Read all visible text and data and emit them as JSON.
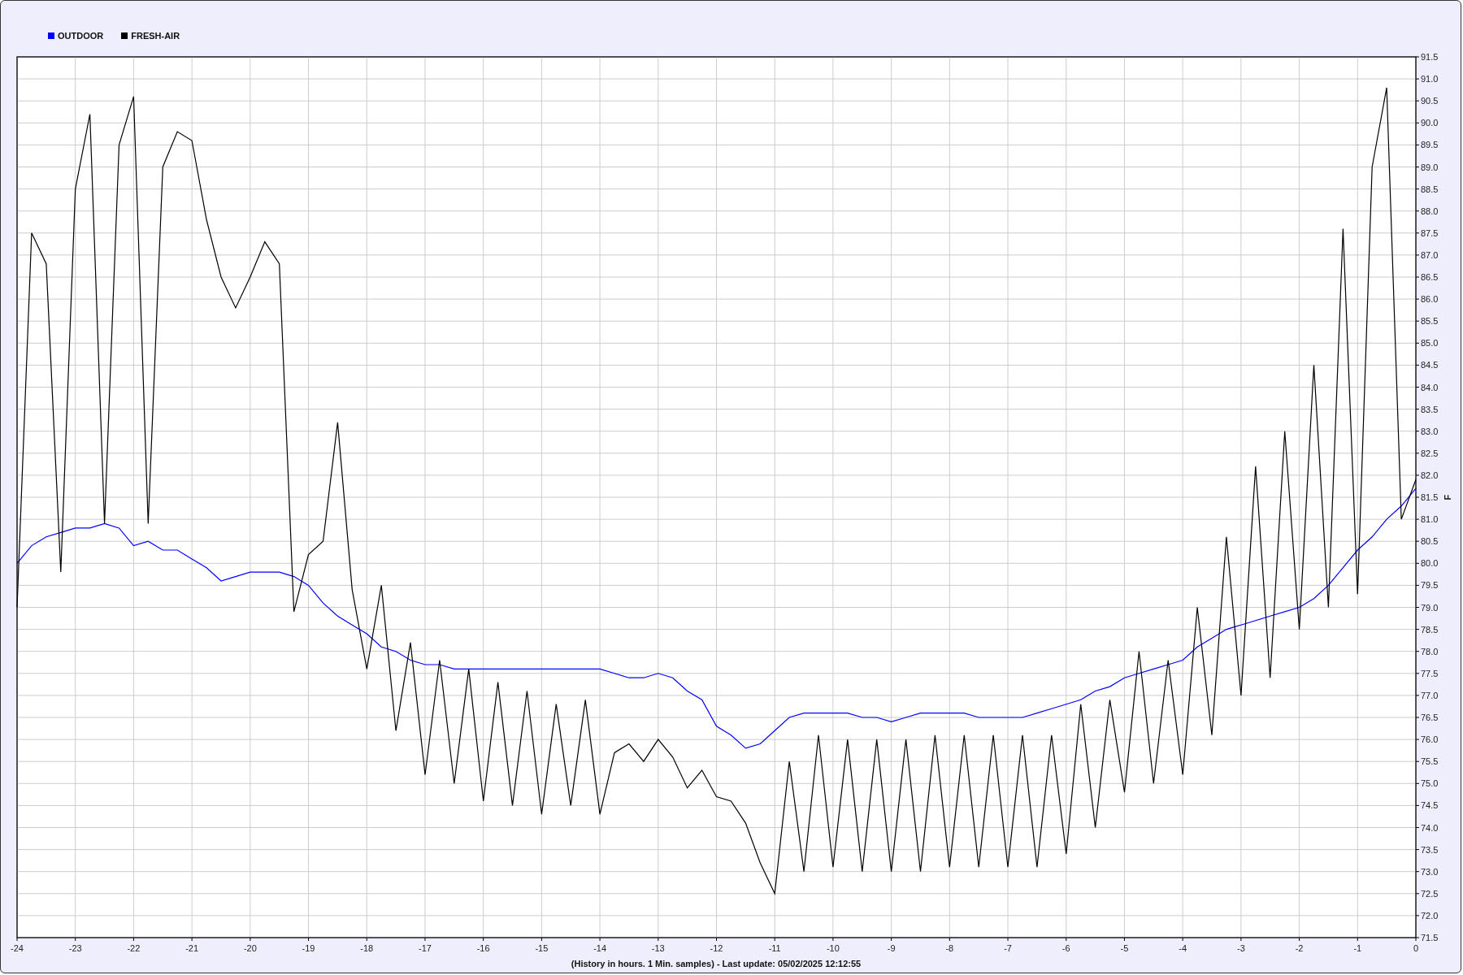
{
  "chart_data": {
    "type": "line",
    "grid": true,
    "xlabel": "(History in hours. 1 Min. samples) - Last update: 05/02/2025 12:12:55",
    "ylabel": "F",
    "x": [
      -24,
      -23.75,
      -23.5,
      -23.25,
      -23,
      -22.75,
      -22.5,
      -22.25,
      -22,
      -21.75,
      -21.5,
      -21.25,
      -21,
      -20.75,
      -20.5,
      -20.25,
      -20,
      -19.75,
      -19.5,
      -19.25,
      -19,
      -18.75,
      -18.5,
      -18.25,
      -18,
      -17.75,
      -17.5,
      -17.25,
      -17,
      -16.75,
      -16.5,
      -16.25,
      -16,
      -15.75,
      -15.5,
      -15.25,
      -15,
      -14.75,
      -14.5,
      -14.25,
      -14,
      -13.75,
      -13.5,
      -13.25,
      -13,
      -12.75,
      -12.5,
      -12.25,
      -12,
      -11.75,
      -11.5,
      -11.25,
      -11,
      -10.75,
      -10.5,
      -10.25,
      -10,
      -9.75,
      -9.5,
      -9.25,
      -9,
      -8.75,
      -8.5,
      -8.25,
      -8,
      -7.75,
      -7.5,
      -7.25,
      -7,
      -6.75,
      -6.5,
      -6.25,
      -6,
      -5.75,
      -5.5,
      -5.25,
      -5,
      -4.75,
      -4.5,
      -4.25,
      -4,
      -3.75,
      -3.5,
      -3.25,
      -3,
      -2.75,
      -2.5,
      -2.25,
      -2,
      -1.75,
      -1.5,
      -1.25,
      -1,
      -0.75,
      -0.5,
      -0.25,
      0
    ],
    "series": [
      {
        "name": "OUTDOOR",
        "color": "#0000ff",
        "values": [
          80.0,
          80.4,
          80.6,
          80.7,
          80.8,
          80.8,
          80.9,
          80.8,
          80.4,
          80.5,
          80.3,
          80.3,
          80.1,
          79.9,
          79.6,
          79.7,
          79.8,
          79.8,
          79.8,
          79.7,
          79.5,
          79.1,
          78.8,
          78.6,
          78.4,
          78.1,
          78.0,
          77.8,
          77.7,
          77.7,
          77.6,
          77.6,
          77.6,
          77.6,
          77.6,
          77.6,
          77.6,
          77.6,
          77.6,
          77.6,
          77.6,
          77.5,
          77.4,
          77.4,
          77.5,
          77.4,
          77.1,
          76.9,
          76.3,
          76.1,
          75.8,
          75.9,
          76.2,
          76.5,
          76.6,
          76.6,
          76.6,
          76.6,
          76.5,
          76.5,
          76.4,
          76.5,
          76.6,
          76.6,
          76.6,
          76.6,
          76.5,
          76.5,
          76.5,
          76.5,
          76.6,
          76.7,
          76.8,
          76.9,
          77.1,
          77.2,
          77.4,
          77.5,
          77.6,
          77.7,
          77.8,
          78.1,
          78.3,
          78.5,
          78.6,
          78.7,
          78.8,
          78.9,
          79.0,
          79.2,
          79.5,
          79.9,
          80.3,
          80.6,
          81.0,
          81.3,
          81.7
        ]
      },
      {
        "name": "FRESH-AIR",
        "color": "#000000",
        "values": [
          79.0,
          87.5,
          86.8,
          79.8,
          88.5,
          90.2,
          80.9,
          89.5,
          90.6,
          80.9,
          89.0,
          89.8,
          89.6,
          87.8,
          86.5,
          85.8,
          86.5,
          87.3,
          86.8,
          78.9,
          80.2,
          80.5,
          83.2,
          79.4,
          77.6,
          79.5,
          76.2,
          78.2,
          75.2,
          77.8,
          75.0,
          77.6,
          74.6,
          77.3,
          74.5,
          77.1,
          74.3,
          76.8,
          74.5,
          76.9,
          74.3,
          75.7,
          75.9,
          75.5,
          76.0,
          75.6,
          74.9,
          75.3,
          74.7,
          74.6,
          74.1,
          73.2,
          72.5,
          75.5,
          73.0,
          76.1,
          73.1,
          76.0,
          73.0,
          76.0,
          73.0,
          76.0,
          73.0,
          76.1,
          73.1,
          76.1,
          73.1,
          76.1,
          73.1,
          76.1,
          73.1,
          76.1,
          73.4,
          76.8,
          74.0,
          76.9,
          74.8,
          78.0,
          75.0,
          77.8,
          75.2,
          79.0,
          76.1,
          80.6,
          77.0,
          82.2,
          77.4,
          83.0,
          78.5,
          84.5,
          79.0,
          87.6,
          79.3,
          89.0,
          90.8,
          81.0,
          81.9
        ]
      }
    ],
    "xlim": [
      -24,
      0
    ],
    "ylim": [
      71.5,
      91.5
    ],
    "xticks": [
      -24,
      -23,
      -22,
      -21,
      -20,
      -19,
      -18,
      -17,
      -16,
      -15,
      -14,
      -13,
      -12,
      -11,
      -10,
      -9,
      -8,
      -7,
      -6,
      -5,
      -4,
      -3,
      -2,
      -1,
      0
    ],
    "yticks": [
      {
        "value": 71.5,
        "label": "71.5"
      },
      {
        "value": 72,
        "label": "72.0"
      },
      {
        "value": 72.5,
        "label": "72.5"
      },
      {
        "value": 73,
        "label": "73.0"
      },
      {
        "value": 73.5,
        "label": "73.5"
      },
      {
        "value": 74,
        "label": "74.0"
      },
      {
        "value": 74.5,
        "label": "74.5"
      },
      {
        "value": 75,
        "label": "75.0"
      },
      {
        "value": 75.5,
        "label": "75.5"
      },
      {
        "value": 76,
        "label": "76.0"
      },
      {
        "value": 76.5,
        "label": "76.5"
      },
      {
        "value": 77,
        "label": "77.0"
      },
      {
        "value": 77.5,
        "label": "77.5"
      },
      {
        "value": 78,
        "label": "78.0"
      },
      {
        "value": 78.5,
        "label": "78.5"
      },
      {
        "value": 79,
        "label": "79.0"
      },
      {
        "value": 79.5,
        "label": "79.5"
      },
      {
        "value": 80,
        "label": "80.0"
      },
      {
        "value": 80.5,
        "label": "80.5"
      },
      {
        "value": 81,
        "label": "81.0"
      },
      {
        "value": 81.5,
        "label": "81.5"
      },
      {
        "value": 82,
        "label": "82.0"
      },
      {
        "value": 82.5,
        "label": "82.5"
      },
      {
        "value": 83,
        "label": "83.0"
      },
      {
        "value": 83.5,
        "label": "83.5"
      },
      {
        "value": 84,
        "label": "84.0"
      },
      {
        "value": 84.5,
        "label": "84.5"
      },
      {
        "value": 85,
        "label": "85.0"
      },
      {
        "value": 85.5,
        "label": "85.5"
      },
      {
        "value": 86,
        "label": "86.0"
      },
      {
        "value": 86.5,
        "label": "86.5"
      },
      {
        "value": 87,
        "label": "87.0"
      },
      {
        "value": 87.5,
        "label": "87.5"
      },
      {
        "value": 88,
        "label": "88.0"
      },
      {
        "value": 88.5,
        "label": "88.5"
      },
      {
        "value": 89,
        "label": "89.0"
      },
      {
        "value": 89.5,
        "label": "89.5"
      },
      {
        "value": 90,
        "label": "90.0"
      },
      {
        "value": 90.5,
        "label": "90.5"
      },
      {
        "value": 91,
        "label": "91.0"
      },
      {
        "value": 91.5,
        "label": "91.5"
      }
    ]
  }
}
